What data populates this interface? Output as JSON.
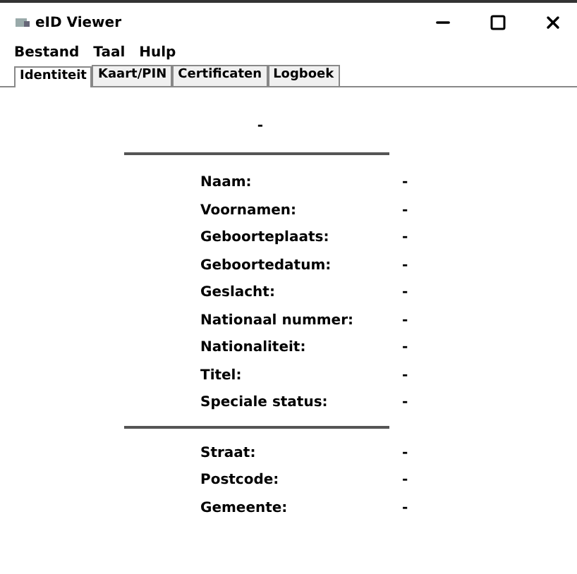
{
  "window": {
    "title": "eID Viewer"
  },
  "menu": [
    "Bestand",
    "Taal",
    "Hulp"
  ],
  "tabs": [
    {
      "label": "Identiteit",
      "selected": true
    },
    {
      "label": "Kaart/PIN",
      "selected": false
    },
    {
      "label": "Certificaten",
      "selected": false
    },
    {
      "label": "Logboek",
      "selected": false
    }
  ],
  "header_value": "-",
  "identity_fields": [
    {
      "label": "Naam:",
      "value": "-"
    },
    {
      "label": "Voornamen:",
      "value": "-"
    },
    {
      "label": "Geboorteplaats:",
      "value": "-"
    },
    {
      "label": "Geboortedatum:",
      "value": "-"
    },
    {
      "label": "Geslacht:",
      "value": "-"
    },
    {
      "label": "Nationaal nummer:",
      "value": "-"
    },
    {
      "label": "Nationaliteit:",
      "value": "-"
    },
    {
      "label": "Titel:",
      "value": "-"
    },
    {
      "label": "Speciale status:",
      "value": "-"
    }
  ],
  "address_fields": [
    {
      "label": "Straat:",
      "value": "-"
    },
    {
      "label": "Postcode:",
      "value": "-"
    },
    {
      "label": "Gemeente:",
      "value": "-"
    }
  ]
}
